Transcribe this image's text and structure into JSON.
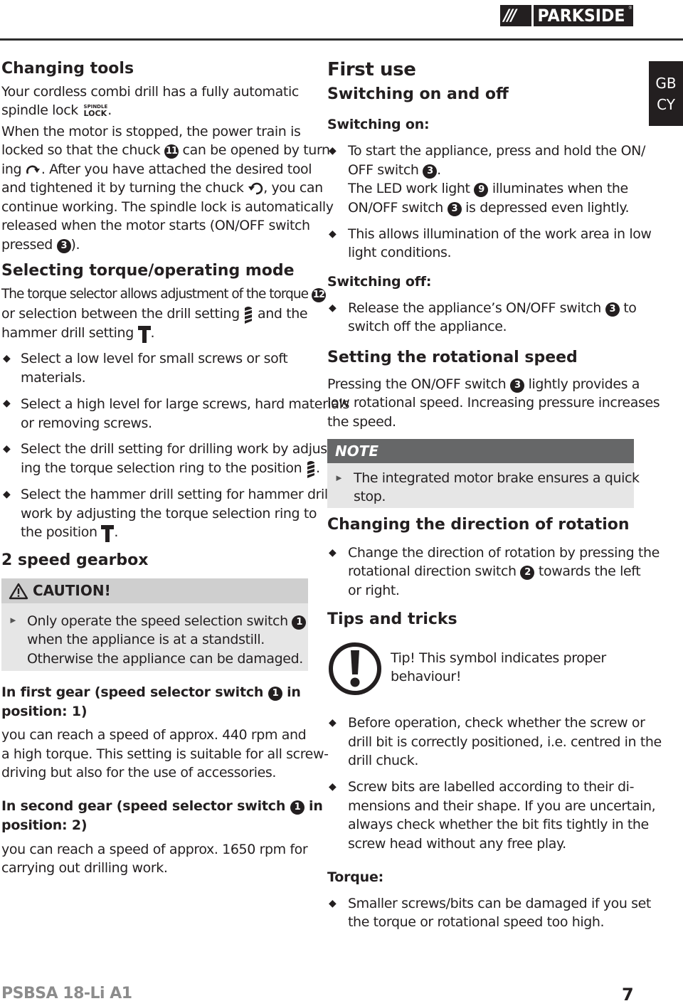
{
  "header": {
    "brand": "PARKSIDE",
    "brand_slashes": "///",
    "registered": "®",
    "language_tab": [
      "GB",
      "CY"
    ]
  },
  "left": {
    "changing_tools": {
      "heading": "Changing tools",
      "lines": [
        "Your cordless combi drill has a fully automatic",
        "spindle lock",
        "When the motor is stopped, the power train is",
        "locked so that the chuck",
        "can be opened by turn-",
        "ing",
        ". After you have attached the desired tool",
        "and tightened it by turning the chuck",
        ", you can",
        "continue working. The spindle lock is automatically",
        "released when the motor starts (ON/OFF switch",
        "pressed",
        ")."
      ],
      "spindle_lock_icon_text": [
        "SPINDLE",
        "LOCK"
      ],
      "refs": {
        "chuck": "11",
        "switch": "3"
      }
    },
    "torque": {
      "heading": "Selecting torque/operating mode",
      "intro": [
        "The torque selector allows adjustment of the torque",
        "or selection between the drill setting",
        "and the",
        "hammer drill setting",
        "."
      ],
      "ref": "12",
      "bullets": [
        [
          "Select a low level for small screws or soft",
          "materials."
        ],
        [
          "Select a high level for large screws, hard materials",
          "or removing screws."
        ],
        [
          "Select the drill setting for drilling work by adjust-",
          "ing the torque selection ring to the position",
          "."
        ],
        [
          "Select the hammer drill setting for hammer drilling",
          "work by adjusting the torque selection ring to",
          "the position",
          "."
        ]
      ]
    },
    "gearbox": {
      "heading": "2 speed gearbox",
      "caution_label": "CAUTION!",
      "caution_lines": [
        "Only operate the speed selection switch",
        "when the appliance is at a standstill.",
        "Otherwise the appliance can be damaged."
      ],
      "ref": "1",
      "first_gear_heading": [
        "In first gear (speed selector switch",
        "in",
        "position: 1)"
      ],
      "first_gear_text": [
        "you can reach a speed of approx. 440 rpm and",
        "a high torque. This setting is suitable for all screw-",
        "driving but also for the use of accessories."
      ],
      "second_gear_heading": [
        "In second gear (speed selector switch",
        "in",
        "position: 2)"
      ],
      "second_gear_text": [
        "you can reach a speed of approx. 1650 rpm for",
        "carrying out drilling work."
      ]
    }
  },
  "right": {
    "first_use": {
      "heading": "First use",
      "subheading": "Switching on and off",
      "switching_on_label": "Switching on:",
      "on_bullets": [
        [
          "To start the appliance, press and hold the ON/",
          "OFF switch",
          ".",
          "The LED work light",
          "illuminates when the",
          "ON/OFF switch",
          "is depressed even lightly."
        ],
        [
          "This allows illumination of the work area in low",
          "light conditions."
        ]
      ],
      "refs": {
        "switch": "3",
        "led": "9"
      },
      "switching_off_label": "Switching off:",
      "off_bullet": [
        "Release the appliance’s ON/OFF switch",
        "to",
        "switch off the appliance."
      ]
    },
    "speed": {
      "heading": "Setting the rotational speed",
      "lines": [
        "Pressing the ON/OFF switch",
        "lightly provides a",
        "low rotational speed. Increasing pressure increases",
        "the speed."
      ],
      "ref": "3",
      "note_label": "NOTE",
      "note_lines": [
        "The integrated motor brake ensures a quick",
        "stop."
      ]
    },
    "direction": {
      "heading": "Changing the direction of rotation",
      "lines": [
        "Change the direction of rotation by pressing the",
        "rotational direction switch",
        "towards the left",
        "or right."
      ],
      "ref": "2"
    },
    "tips": {
      "heading": "Tips and tricks",
      "tip_lines": [
        "Tip! This symbol indicates proper",
        "behaviour!"
      ],
      "bullets": [
        [
          "Before operation, check whether the screw or",
          "drill bit is correctly positioned, i.e. centred in the",
          "drill chuck."
        ],
        [
          "Screw bits are labelled according to their di-",
          "mensions and their shape. If you are uncertain,",
          "always check whether the bit fits tightly in the",
          "screw head without any free play."
        ]
      ],
      "torque_label": "Torque:",
      "torque_bullet": [
        "Smaller screws/bits can be damaged if you set",
        "the torque or rotational speed too high."
      ]
    }
  },
  "footer": {
    "model": "PSBSA 18-Li A1",
    "page": "7"
  }
}
